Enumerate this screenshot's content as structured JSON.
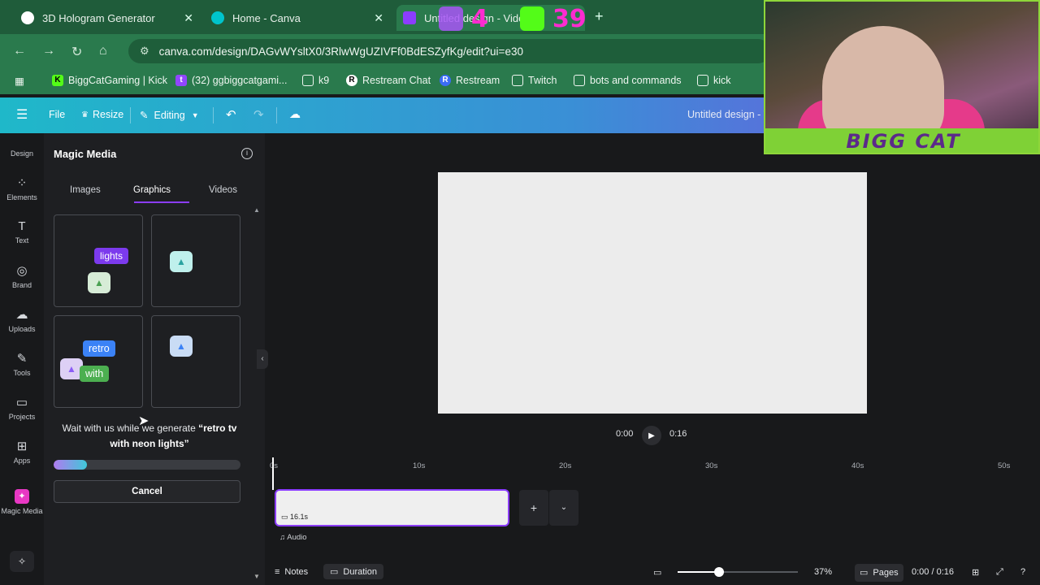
{
  "browser": {
    "tabs": [
      {
        "label": "3D Hologram Generator",
        "favicon_color": "#ffffff"
      },
      {
        "label": "Home - Canva",
        "favicon_color": "#00c4cc"
      },
      {
        "label": "Untitled design - Video",
        "favicon_color": "#8b3dff"
      }
    ],
    "url": "canva.com/design/DAGvWYsltX0/3RlwWgUZIVFf0BdESZyfKg/edit?ui=e30",
    "bookmarks": [
      {
        "label": "BiggCatGaming | Kick",
        "icon": "K"
      },
      {
        "label": "(32) ggbiggcatgami...",
        "icon": "tw"
      },
      {
        "label": "k9",
        "icon": "folder"
      },
      {
        "label": "Restream Chat",
        "icon": "R"
      },
      {
        "label": "Restream",
        "icon": "R"
      },
      {
        "label": "Twitch",
        "icon": "folder"
      },
      {
        "label": "bots and commands",
        "icon": "folder"
      },
      {
        "label": "kick",
        "icon": "folder"
      }
    ]
  },
  "overlay": {
    "twitch_count": "4",
    "kick_count": "39",
    "cam_banner": "BIGG CAT"
  },
  "header": {
    "file_label": "File",
    "resize_label": "Resize",
    "editing_label": "Editing",
    "design_title": "Untitled design - V"
  },
  "rail": [
    {
      "label": "Design",
      "icon": "design-icon"
    },
    {
      "label": "Elements",
      "icon": "elements-icon"
    },
    {
      "label": "Text",
      "icon": "text-icon"
    },
    {
      "label": "Brand",
      "icon": "brand-icon"
    },
    {
      "label": "Uploads",
      "icon": "uploads-icon"
    },
    {
      "label": "Tools",
      "icon": "tools-icon"
    },
    {
      "label": "Projects",
      "icon": "projects-icon"
    },
    {
      "label": "Apps",
      "icon": "apps-icon"
    },
    {
      "label": "Magic Media",
      "icon": "magic-media-icon"
    }
  ],
  "panel": {
    "title": "Magic Media",
    "tabs": [
      "Images",
      "Graphics",
      "Videos"
    ],
    "active_tab": "Graphics",
    "chips": {
      "lights": "lights",
      "retro": "retro",
      "with": "with"
    },
    "status_prefix": "Wait with us while we generate ",
    "status_prompt": "“retro tv with neon lights”",
    "progress": 0.18,
    "cancel_label": "Cancel"
  },
  "player": {
    "current": "0:00",
    "total": "0:16"
  },
  "timeline": {
    "ticks": [
      "0s",
      "10s",
      "20s",
      "30s",
      "40s",
      "50s"
    ],
    "clip_label": "16.1s",
    "audio_label": "Audio"
  },
  "footer": {
    "notes_label": "Notes",
    "duration_label": "Duration",
    "zoom": "37%",
    "pages_label": "Pages",
    "time": "0:00 / 0:16"
  },
  "colors": {
    "accent": "#8b3dff",
    "browser_green": "#2a7a4d"
  }
}
